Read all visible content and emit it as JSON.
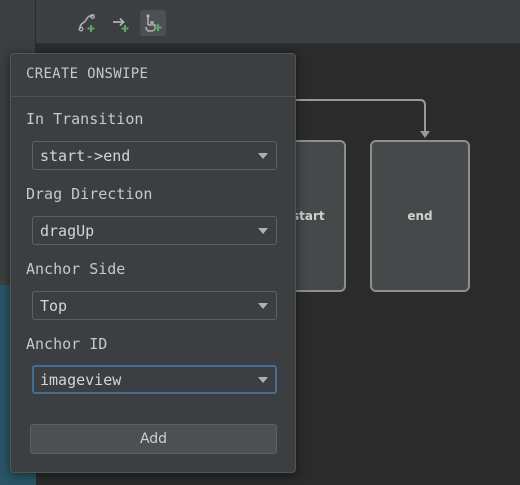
{
  "toolbar": {
    "buttons": [
      {
        "icon": "create-transition-icon",
        "active": false
      },
      {
        "icon": "create-click-handler-icon",
        "active": false
      },
      {
        "icon": "create-onswipe-icon",
        "active": true
      }
    ],
    "accent_plus_color": "#59a869"
  },
  "canvas": {
    "start_label": "start",
    "end_label": "end"
  },
  "popup": {
    "title": "CREATE ONSWIPE",
    "fields": [
      {
        "label": "In Transition",
        "value": "start->end"
      },
      {
        "label": "Drag Direction",
        "value": "dragUp"
      },
      {
        "label": "Anchor Side",
        "value": "Top"
      },
      {
        "label": "Anchor ID",
        "value": "imageview"
      }
    ],
    "add_label": "Add"
  }
}
